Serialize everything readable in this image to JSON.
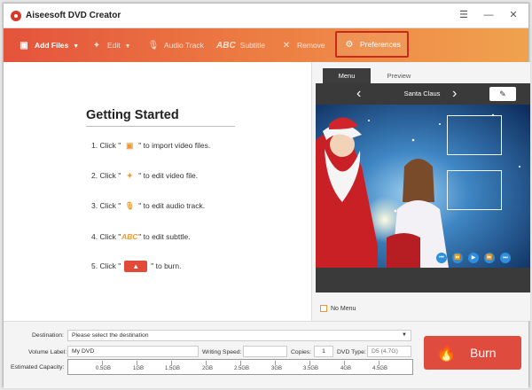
{
  "app": {
    "title": "Aiseesoft DVD Creator"
  },
  "window_controls": {
    "menu": "☰",
    "minimize": "—",
    "close": "✕"
  },
  "toolbar": {
    "add_files": "Add Files",
    "edit": "Edit",
    "audio_track": "Audio Track",
    "subtitle": "Subtitle",
    "remove": "Remove",
    "preferences": "Preferences",
    "subtitle_icon": "ABC"
  },
  "getting_started": {
    "title": "Getting Started",
    "steps": [
      {
        "num": "1. Click \"",
        "icon": "add-files-icon",
        "text": "\" to import video files."
      },
      {
        "num": "2. Click \"",
        "icon": "edit-icon",
        "text": "\" to edit video file."
      },
      {
        "num": "3. Click \"",
        "icon": "audio-icon",
        "text": "\" to edit audio track."
      },
      {
        "num": "4. Click \"",
        "icon": "subtitle-icon",
        "text": "\" to edit subttle."
      },
      {
        "num": "5. Click \"",
        "icon": "burn-icon",
        "text": "\" to burn."
      }
    ],
    "abc": "ABC"
  },
  "preview_panel": {
    "tabs": [
      "Menu",
      "Preview"
    ],
    "active_tab": "Menu",
    "template_name": "Santa Claus",
    "no_menu_label": "No Menu"
  },
  "bottom": {
    "destination_label": "Destination:",
    "destination_placeholder": "Please select the destination",
    "volume_label": "Volume Label:",
    "volume_value": "My DVD",
    "writing_speed_label": "Writing Speed:",
    "copies_label": "Copies:",
    "copies_value": "1",
    "dvd_type_label": "DVD Type:",
    "dvd_type_value": "D5 (4.7G)",
    "capacity_label": "Estimated Capacity:",
    "capacity_ticks": [
      "0.5GB",
      "1GB",
      "1.5GB",
      "2GB",
      "2.5GB",
      "3GB",
      "3.5GB",
      "4GB",
      "4.5GB"
    ],
    "burn_label": "Burn"
  },
  "colors": {
    "accent": "#e4533c",
    "burn": "#df4b3d",
    "highlight_border": "#c82a1c"
  }
}
